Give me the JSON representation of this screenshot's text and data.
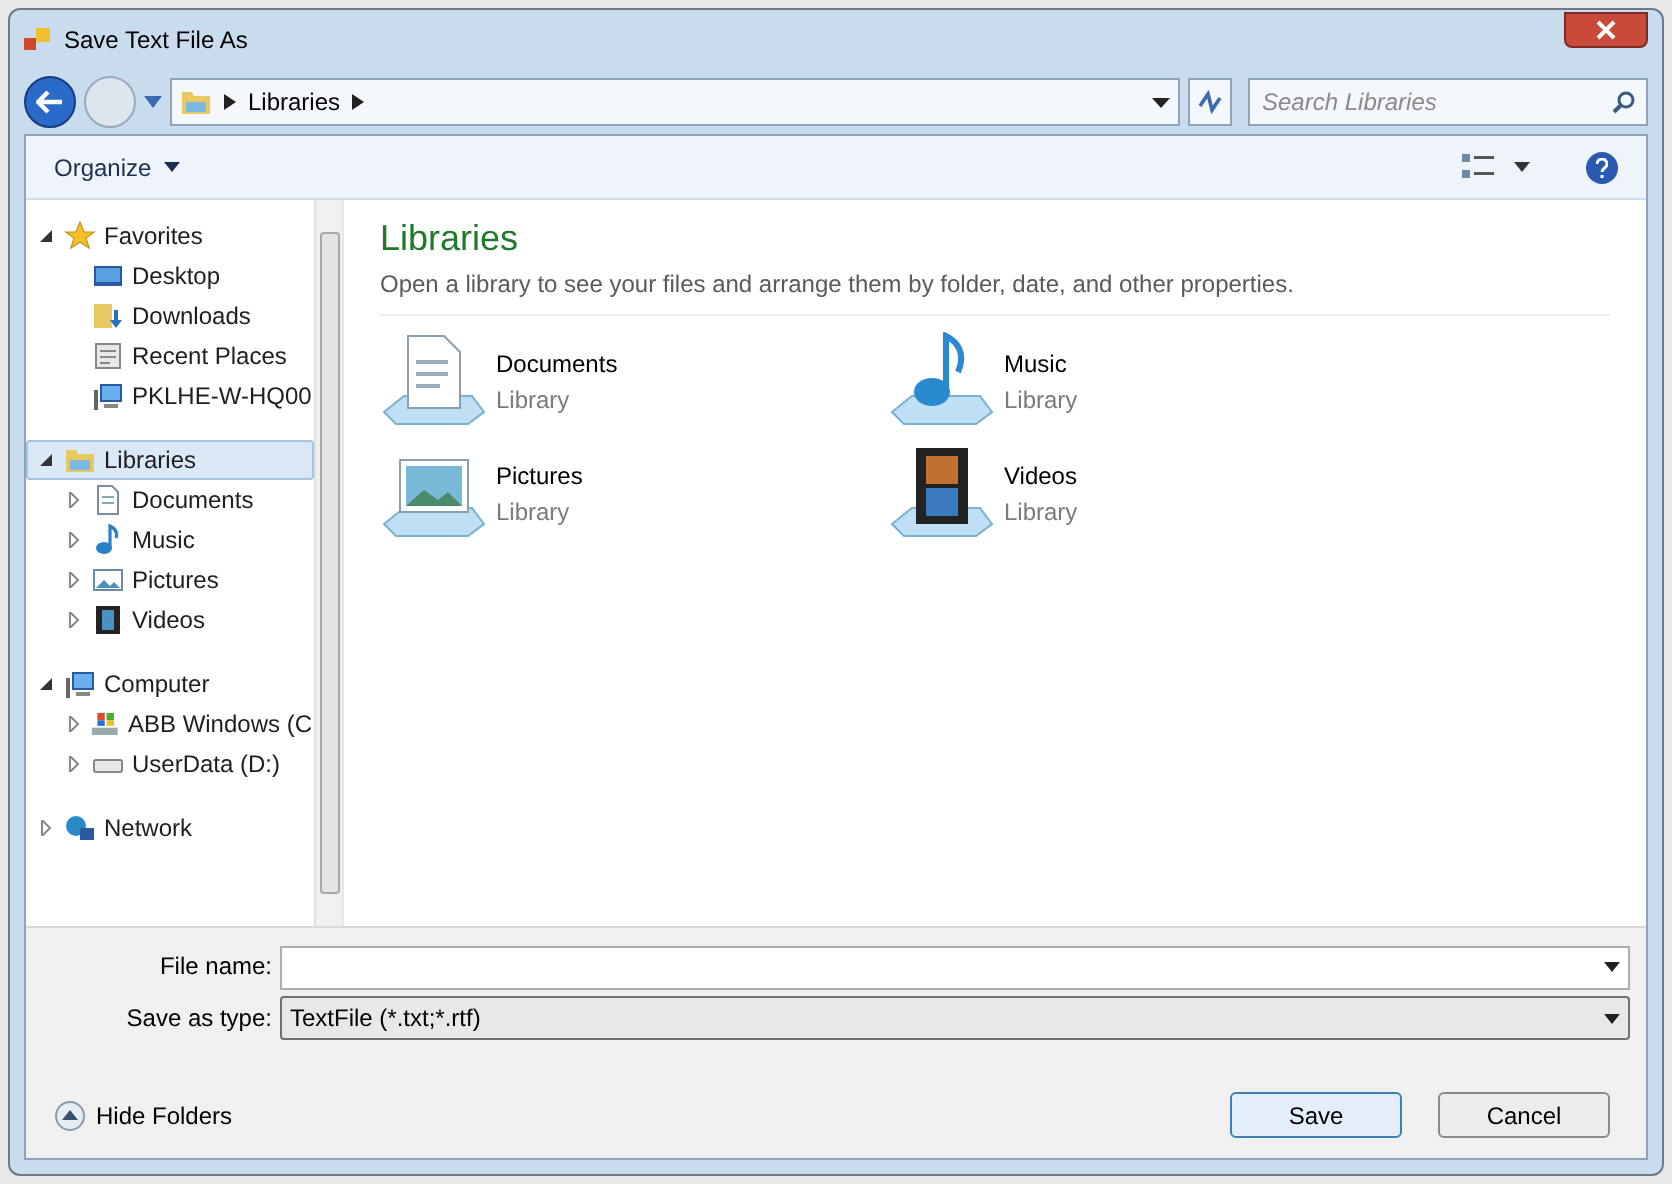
{
  "window": {
    "title": "Save Text File As"
  },
  "address": {
    "crumbs": [
      "Libraries"
    ]
  },
  "search": {
    "placeholder": "Search Libraries"
  },
  "toolbar": {
    "organize": "Organize"
  },
  "nav": [
    {
      "label": "Favorites",
      "kind": "star",
      "expanded": true,
      "selected": false,
      "children": [
        {
          "label": "Desktop",
          "kind": "desktop",
          "selected": false
        },
        {
          "label": "Downloads",
          "kind": "downloads",
          "selected": false
        },
        {
          "label": "Recent Places",
          "kind": "recent",
          "selected": false
        },
        {
          "label": "PKLHE-W-HQ00",
          "kind": "computer",
          "selected": false
        }
      ]
    },
    {
      "label": "Libraries",
      "kind": "library",
      "expanded": true,
      "selected": true,
      "children": [
        {
          "label": "Documents",
          "kind": "documents",
          "expanded": false,
          "selected": false
        },
        {
          "label": "Music",
          "kind": "music",
          "expanded": false,
          "selected": false
        },
        {
          "label": "Pictures",
          "kind": "pictures",
          "expanded": false,
          "selected": false
        },
        {
          "label": "Videos",
          "kind": "videos",
          "expanded": false,
          "selected": false
        }
      ]
    },
    {
      "label": "Computer",
      "kind": "computer",
      "expanded": true,
      "selected": false,
      "children": [
        {
          "label": "ABB Windows (C",
          "kind": "windrive",
          "expanded": false,
          "selected": false
        },
        {
          "label": "UserData (D:)",
          "kind": "drive",
          "expanded": false,
          "selected": false
        }
      ]
    },
    {
      "label": "Network",
      "kind": "network",
      "expanded": false,
      "selected": false
    }
  ],
  "content": {
    "title": "Libraries",
    "description": "Open a library to see your files and arrange them by folder, date, and other properties.",
    "items": [
      {
        "name": "Documents",
        "type": "Library",
        "kind": "documents"
      },
      {
        "name": "Music",
        "type": "Library",
        "kind": "music"
      },
      {
        "name": "Pictures",
        "type": "Library",
        "kind": "pictures"
      },
      {
        "name": "Videos",
        "type": "Library",
        "kind": "videos"
      }
    ]
  },
  "form": {
    "file_name_label": "File name:",
    "save_type_label": "Save as type:",
    "save_type_value": "TextFile (*.txt;*.rtf)"
  },
  "footer": {
    "hide_folders": "Hide Folders",
    "buttons": [
      "Save",
      "Cancel"
    ]
  }
}
